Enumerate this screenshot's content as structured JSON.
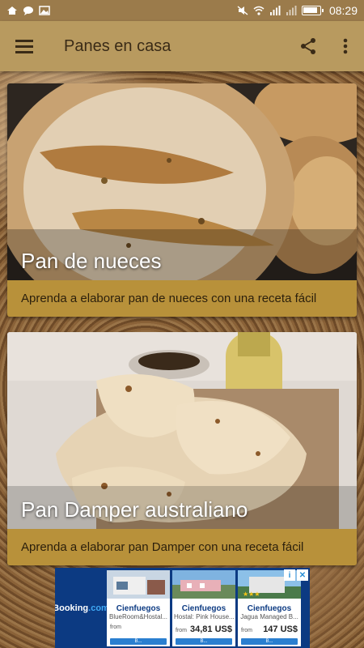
{
  "status_bar": {
    "time": "08:29"
  },
  "app_bar": {
    "title": "Panes en casa"
  },
  "recipes": [
    {
      "title": "Pan de nueces",
      "description": "Aprenda a elaborar pan de nueces con una receta fácil"
    },
    {
      "title": "Pan Damper australiano",
      "description": "Aprenda a elaborar pan Damper con una receta fácil"
    }
  ],
  "ad": {
    "brand": "Booking",
    "brand_suffix": ".com",
    "hotels": [
      {
        "city": "Cienfuegos",
        "name": "BlueRoom&Hostal...",
        "from": "from",
        "price": "",
        "button": "B..."
      },
      {
        "city": "Cienfuegos",
        "name": "Hostal: Pink House...",
        "from": "from",
        "price": "34,81 US$",
        "button": "B..."
      },
      {
        "city": "Cienfuegos",
        "name": "Jagua Managed B...",
        "from": "from",
        "price": "147 US$",
        "button": "B..."
      }
    ],
    "info_icon": "i",
    "close_icon": "✕"
  },
  "colors": {
    "status_bar": "#9b7b4b",
    "app_bar": "#b89a5f",
    "card_caption": "#b8913a"
  }
}
